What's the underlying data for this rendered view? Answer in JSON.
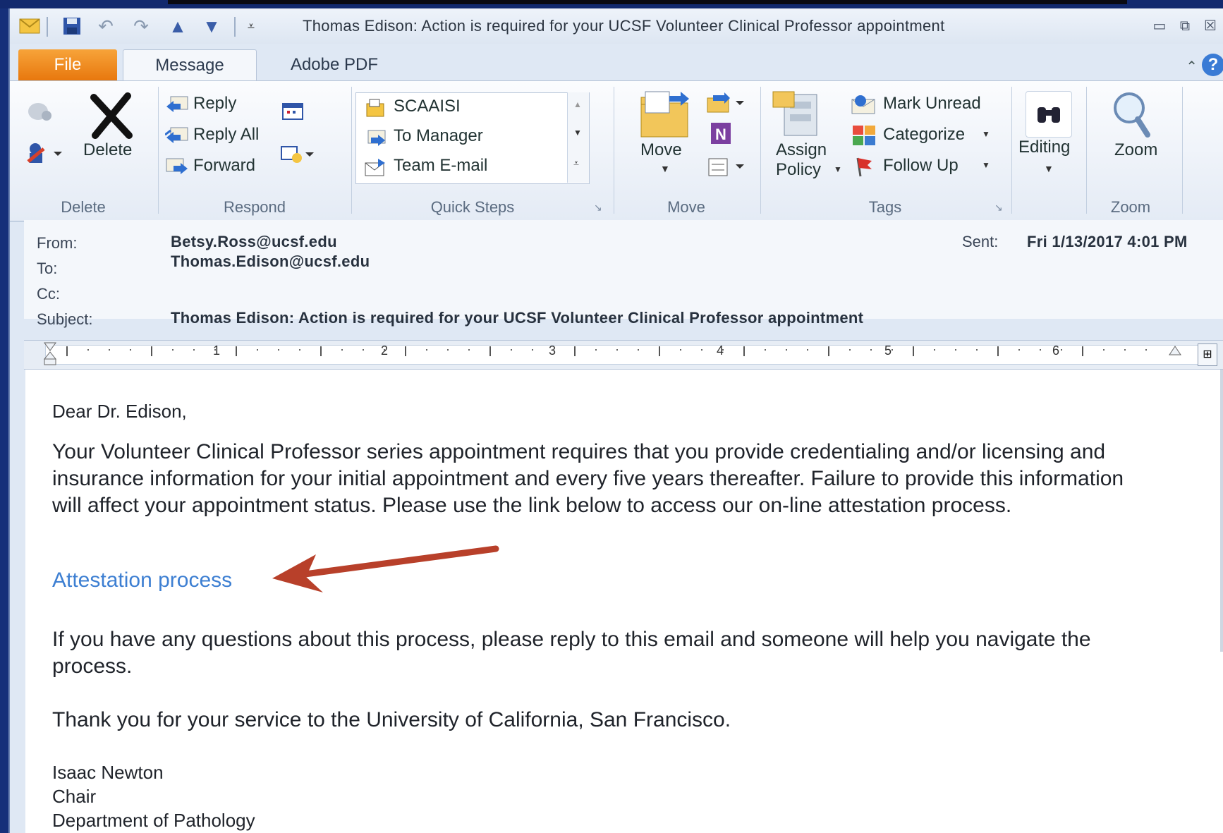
{
  "window": {
    "title": "Thomas Edison: Action is required for your UCSF Volunteer Clinical Professor appointment",
    "quick_access_icons": [
      "mail-icon",
      "save-icon",
      "undo-icon",
      "redo-icon",
      "previous-item-icon",
      "next-item-icon",
      "customize-qat-icon"
    ],
    "controls": [
      "minimize-icon",
      "restore-icon",
      "close-icon"
    ]
  },
  "tabs": [
    "File",
    "Message",
    "Adobe PDF"
  ],
  "ribbon": {
    "delete_group": {
      "label": "Delete",
      "delete_label": "Delete"
    },
    "respond_group": {
      "label": "Respond",
      "reply": "Reply",
      "reply_all": "Reply All",
      "forward": "Forward"
    },
    "quick_steps_group": {
      "label": "Quick Steps",
      "items": [
        "SCAAISI",
        "To Manager",
        "Team E-mail"
      ]
    },
    "move_group": {
      "label": "Move",
      "move_label": "Move"
    },
    "tags_group": {
      "label": "Tags",
      "assign_policy_1": "Assign",
      "assign_policy_2": "Policy",
      "mark_unread": "Mark Unread",
      "categorize": "Categorize",
      "follow_up": "Follow Up"
    },
    "editing_group": {
      "editing_label": "Editing"
    },
    "zoom_group": {
      "label": "Zoom",
      "zoom_label": "Zoom"
    }
  },
  "header": {
    "from_label": "From:",
    "from_value": "Betsy.Ross@ucsf.edu",
    "to_label": "To:",
    "to_value": "Thomas.Edison@ucsf.edu",
    "cc_label": "Cc:",
    "subject_label": "Subject:",
    "subject_value": "Thomas Edison: Action is required for your UCSF Volunteer Clinical Professor appointment",
    "sent_label": "Sent:",
    "sent_value": "Fri 1/13/2017 4:01 PM"
  },
  "ruler": {
    "numbers": [
      "1",
      "2",
      "3",
      "4",
      "5",
      "6"
    ]
  },
  "body": {
    "greeting": "Dear Dr. Edison,",
    "paragraph1": "Your Volunteer Clinical Professor series appointment requires that you provide credentialing and/or licensing and insurance information for your initial appointment and every five years thereafter. Failure to provide this information will affect your appointment status. Please use the link below to access our on-line attestation process.",
    "link_text": "Attestation process",
    "paragraph2": "If you have any questions about this process, please reply to this email and someone will help you navigate the process.",
    "paragraph3": "Thank you for your service to the University of California, San Francisco.",
    "signature_name": "Isaac Newton",
    "signature_title": "Chair",
    "signature_dept": "Department of Pathology"
  },
  "colors": {
    "accent_file_tab": "#e8780e",
    "link": "#3d7fd2",
    "annotation_arrow": "#b8402a"
  }
}
